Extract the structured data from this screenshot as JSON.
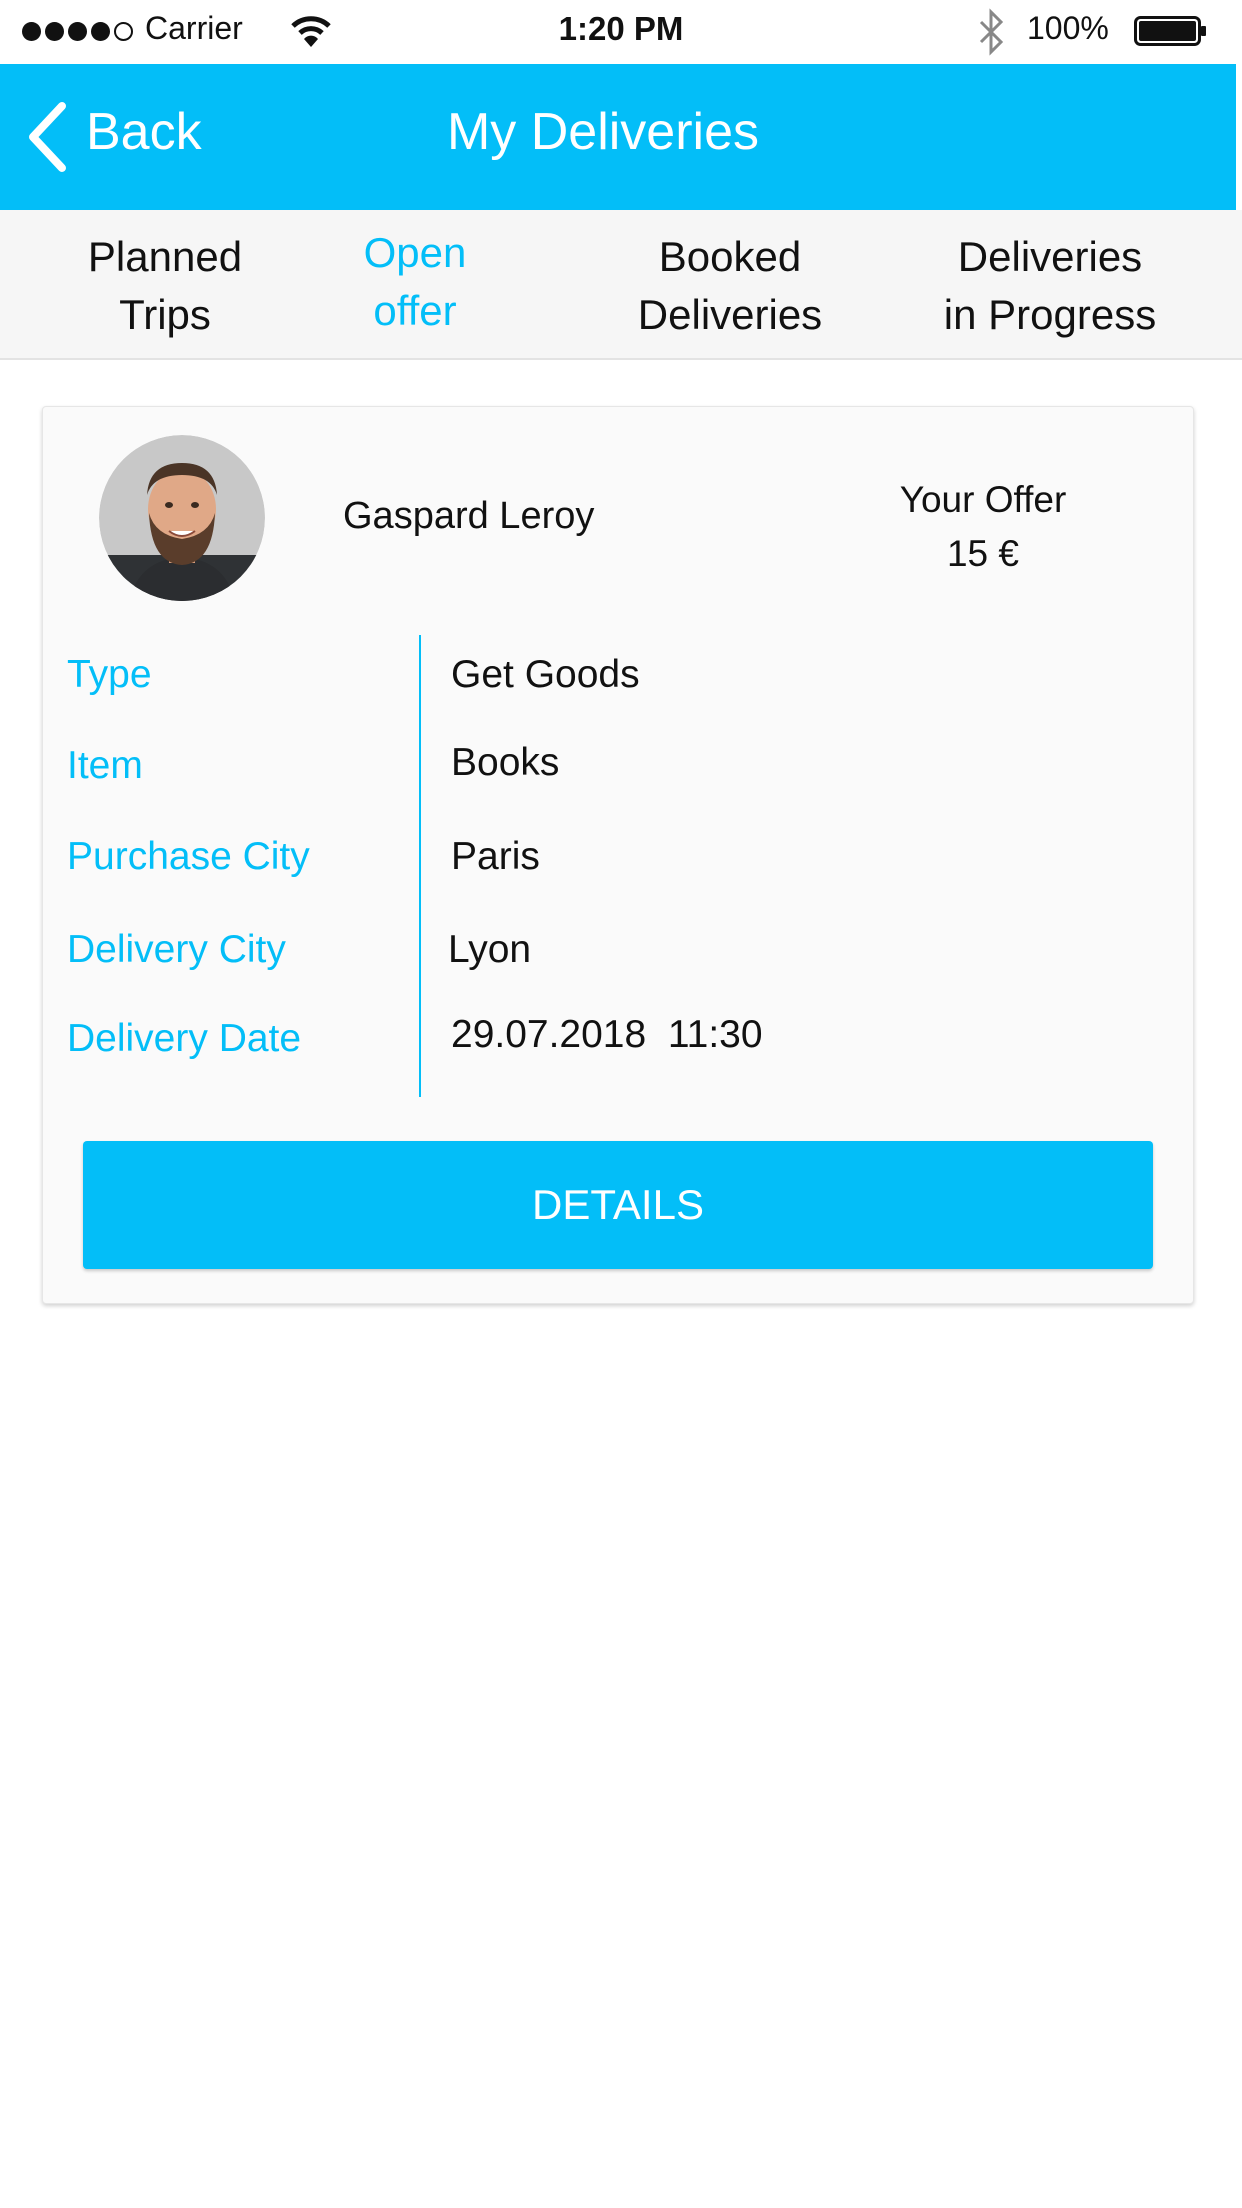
{
  "colors": {
    "accent": "#03bef8"
  },
  "status_bar": {
    "signal_bars_filled": 4,
    "signal_bars_total": 5,
    "carrier": "Carrier",
    "time": "1:20 PM",
    "battery": "100%",
    "icons": [
      "wifi-icon",
      "bluetooth-icon",
      "battery-icon"
    ]
  },
  "header": {
    "back_label": "Back",
    "title": "My Deliveries",
    "icons": [
      "chevron-left-icon"
    ]
  },
  "tabs": [
    {
      "line1": "Planned",
      "line2": "Trips",
      "active": false
    },
    {
      "line1": "Open",
      "line2": "offer",
      "active": true
    },
    {
      "line1": "Booked",
      "line2": "Deliveries",
      "active": false
    },
    {
      "line1": "Deliveries",
      "line2": "in Progress",
      "active": false
    }
  ],
  "card": {
    "user_name": "Gaspard Leroy",
    "offer_label": "Your Offer",
    "offer_value": "15 €",
    "rows": [
      {
        "label": "Type",
        "value": "Get Goods"
      },
      {
        "label": "Item",
        "value": "Books"
      },
      {
        "label": "Purchase City",
        "value": "Paris"
      },
      {
        "label": "Delivery City",
        "value": "Lyon"
      },
      {
        "label": "Delivery Date",
        "value": "29.07.2018  11:30"
      }
    ],
    "details_button": "DETAILS"
  }
}
